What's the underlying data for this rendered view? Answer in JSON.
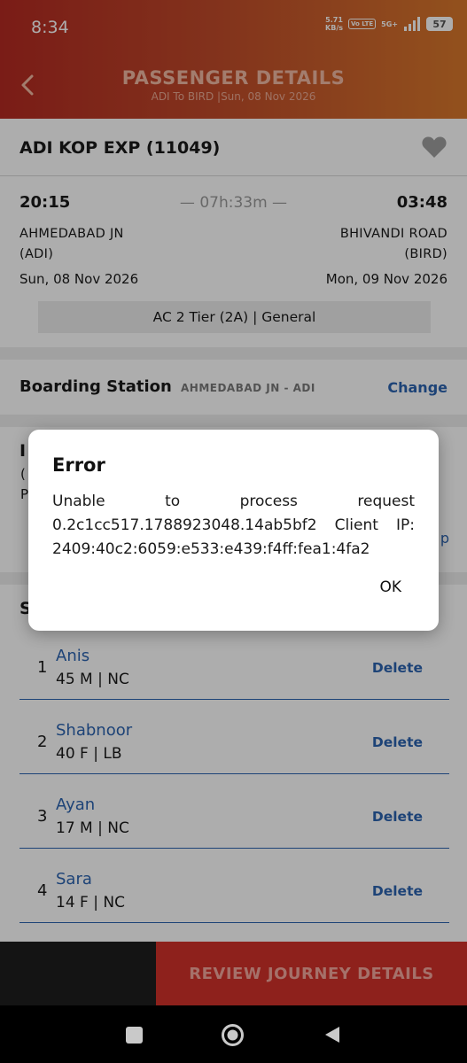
{
  "status_bar": {
    "time": "8:34",
    "speed_value": "5.71",
    "speed_unit": "KB/s",
    "volte": "Vo LTE",
    "network": "5G+",
    "battery": "57"
  },
  "header": {
    "title": "PASSENGER DETAILS",
    "subtitle": "ADI To BIRD |Sun, 08 Nov 2026",
    "back_icon": "chevron-left-icon"
  },
  "train": {
    "name": "ADI KOP  EXP (11049)",
    "favorite_icon": "heart-icon",
    "departure_time": "20:15",
    "arrival_time": "03:48",
    "duration": "— 07h:33m —",
    "from_station_line1": "AHMEDABAD JN",
    "from_station_line2": "(ADI)",
    "to_station_line1": "BHIVANDI ROAD",
    "to_station_line2": "(BIRD)",
    "departure_date": "Sun, 08 Nov 2026",
    "arrival_date": "Mon, 09 Nov 2026",
    "class_quota": "AC 2 Tier (2A) | General"
  },
  "boarding": {
    "label": "Boarding Station",
    "value": "AHMEDABAD JN - ADI",
    "change_label": "Change"
  },
  "partially_hidden": {
    "section_initial": "I",
    "line1_fragment": "(",
    "line2_fragment": "P",
    "right_fragment": "p",
    "passenger_section_initial": "S"
  },
  "passengers": [
    {
      "index": "1",
      "name": "Anis",
      "detail": "45 M | NC",
      "delete_label": "Delete"
    },
    {
      "index": "2",
      "name": "Shabnoor",
      "detail": "40 F | LB",
      "delete_label": "Delete"
    },
    {
      "index": "3",
      "name": "Ayan",
      "detail": "17 M | NC",
      "delete_label": "Delete"
    },
    {
      "index": "4",
      "name": "Sara",
      "detail": "14 F | NC",
      "delete_label": "Delete"
    }
  ],
  "footer": {
    "review_button": "REVIEW JOURNEY DETAILS"
  },
  "dialog": {
    "title": "Error",
    "message": "Unable to process request 0.2c1cc517.1788923048.14ab5bf2 Client IP: 2409:40c2:6059:e533:e439:f4ff:fea1:4fa2",
    "ok_label": "OK"
  },
  "colors": {
    "header_start": "#b42a22",
    "header_end": "#d8782c",
    "accent_blue": "#2c63b0",
    "review_button": "#d2322a"
  }
}
